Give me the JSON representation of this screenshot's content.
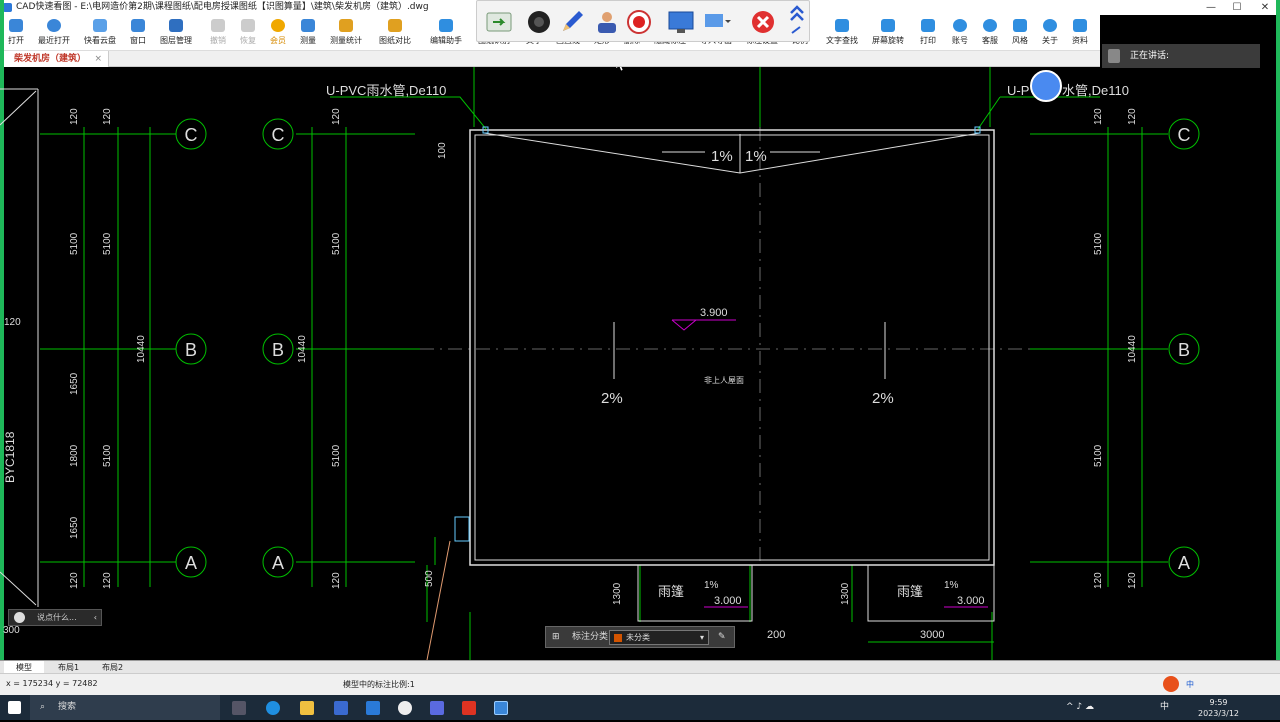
{
  "window": {
    "title": "CAD快速看图 - E:\\电网造价第2期\\课程图纸\\配电房授课图纸【识图算量】\\建筑\\柴发机房（建筑）.dwg"
  },
  "toolbar": {
    "items": [
      "打开",
      "最近打开",
      "快看云盘",
      "窗口",
      "图层管理",
      "撤销",
      "恢复",
      "会员",
      "测量",
      "测量统计",
      "图纸对比",
      "编辑助手",
      "图纸识别",
      "文字",
      "画直线",
      "矩形",
      "删除",
      "隐藏标注",
      "导入导出",
      "标注设置",
      "比例",
      "文字查找",
      "屏幕旋转",
      "打印",
      "账号",
      "客服",
      "风格",
      "关于",
      "资料"
    ]
  },
  "tab": {
    "label": "柴发机房（建筑）",
    "close": "×"
  },
  "speaker": {
    "label": "正在讲话:"
  },
  "drawing": {
    "pipe_left": "U-PVC雨水管,De110",
    "pipe_right_a": "U-P",
    "pipe_right_b": "水管,De110",
    "axis_c": "C",
    "axis_b": "B",
    "axis_a": "A",
    "slope_1": "1%",
    "slope_2": "1%",
    "slope_mid_left": "2%",
    "slope_mid_right": "2%",
    "elev_roof": "3.900",
    "roof_label": "非上人屋面",
    "canopy": "雨篷",
    "canopy_slope": "1%",
    "canopy_elev": "3.000",
    "dims": {
      "d120": "120",
      "d5100": "5100",
      "d10440": "10440",
      "d1650": "1650",
      "d1800": "1800",
      "d100": "100",
      "d500": "500",
      "d1300": "1300",
      "d3000": "3000",
      "d200": "200",
      "d300": "300",
      "byc": "BYC1818"
    }
  },
  "cmd": {
    "placeholder": "说点什么..."
  },
  "annotation": {
    "label": "标注分类",
    "selected": "未分类"
  },
  "layout_tabs": [
    "模型",
    "布局1",
    "布局2"
  ],
  "status": {
    "coords": "x = 175234  y = 72482",
    "scale": "模型中的标注比例:1"
  },
  "taskbar": {
    "search": "搜索",
    "time": "9:59",
    "date": "2023/3/12",
    "ime_a": "中",
    "ime_b": "中"
  }
}
